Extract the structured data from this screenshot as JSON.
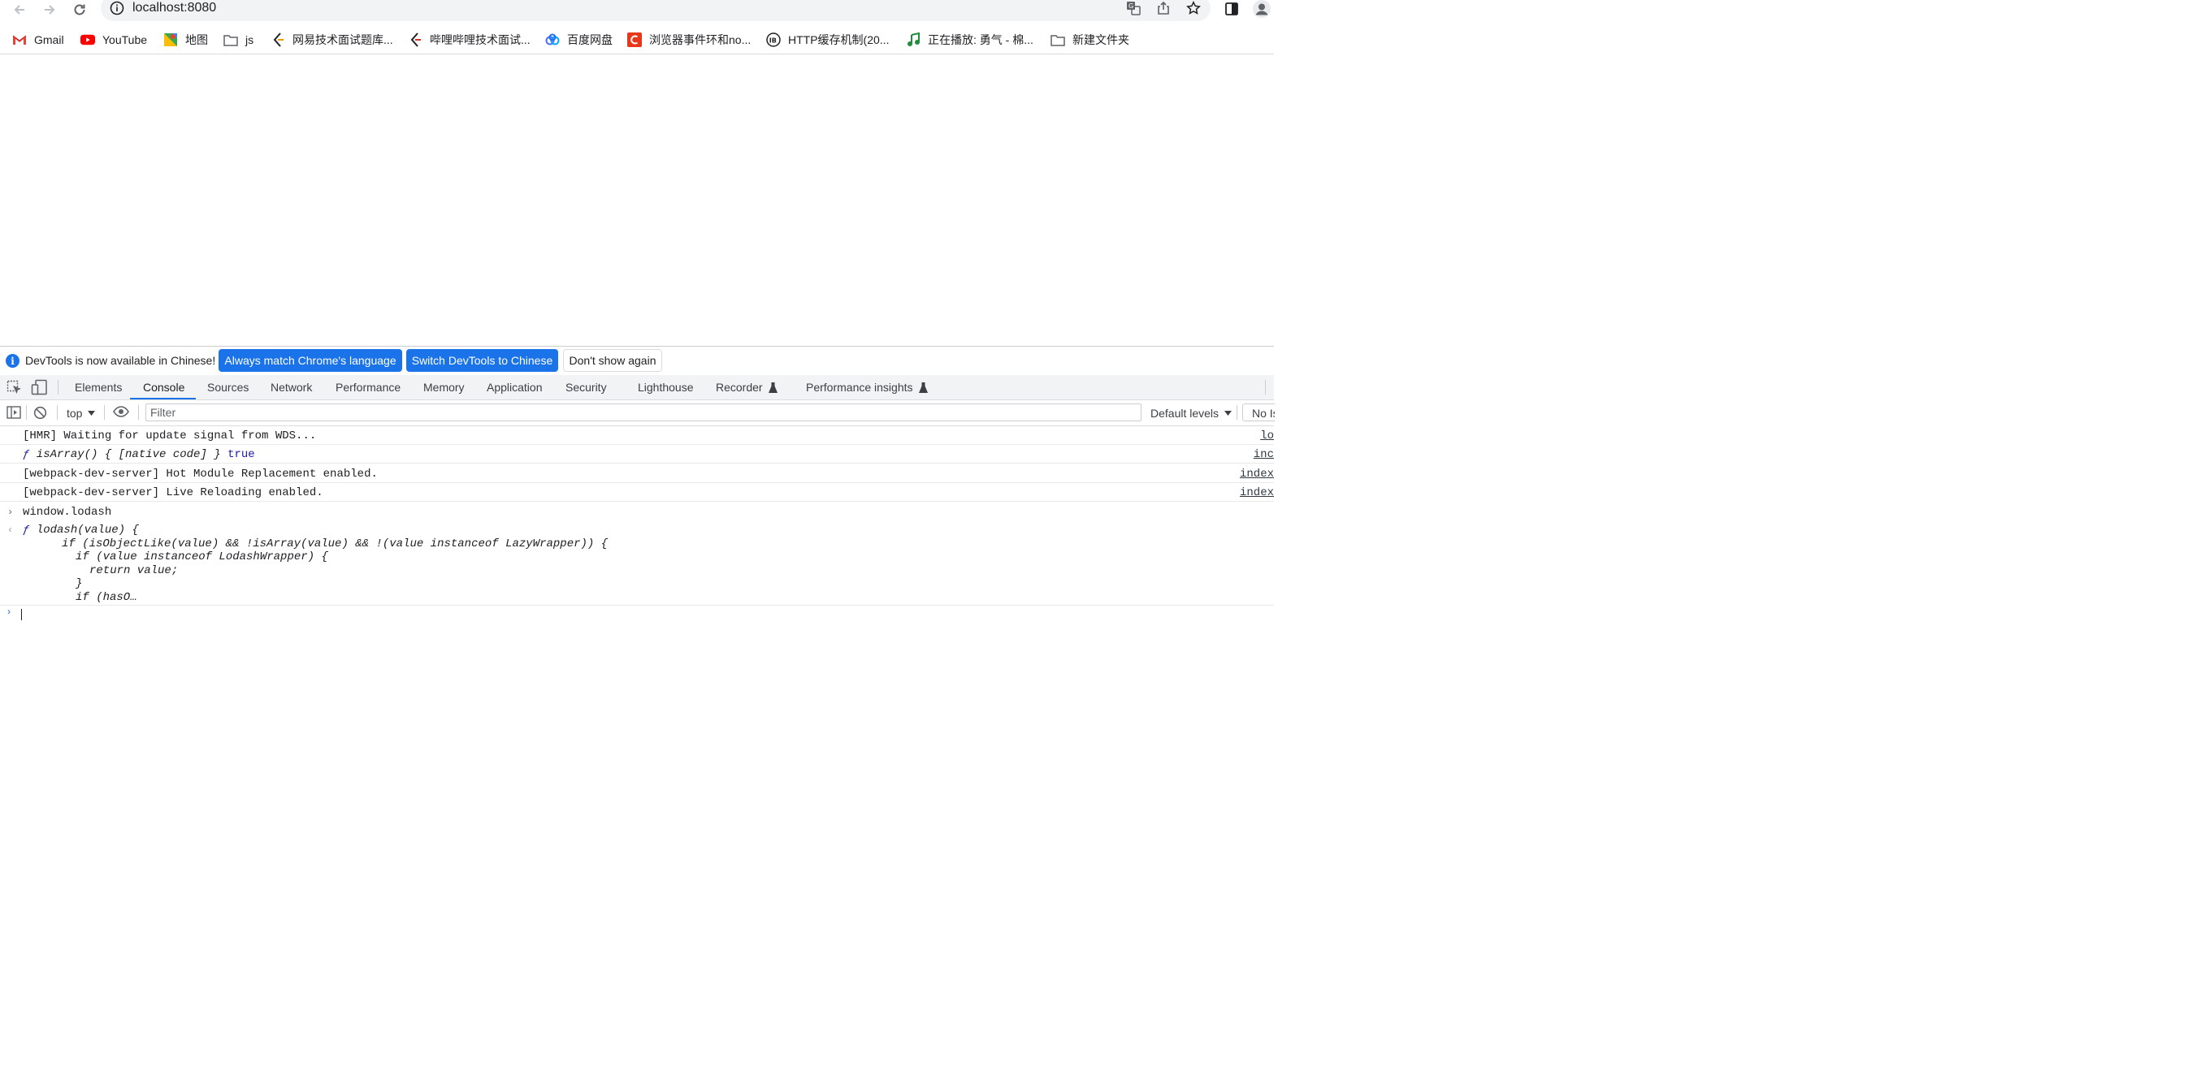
{
  "browser": {
    "url": "localhost:8080",
    "bookmarks": [
      {
        "label": "Gmail",
        "icon": "gmail-icon"
      },
      {
        "label": "YouTube",
        "icon": "youtube-icon"
      },
      {
        "label": "地图",
        "icon": "maps-icon"
      },
      {
        "label": "js",
        "icon": "folder-icon"
      },
      {
        "label": "网易技术面试题库...",
        "icon": "nowcoder-icon"
      },
      {
        "label": "哔哩哔哩技术面试...",
        "icon": "nowcoder-icon"
      },
      {
        "label": "百度网盘",
        "icon": "baidu-pan-icon"
      },
      {
        "label": "浏览器事件环和no...",
        "icon": "c-letter-icon"
      },
      {
        "label": "HTTP缓存机制(20...",
        "icon": "ib-circle-icon"
      },
      {
        "label": "正在播放: 勇气 - 棉...",
        "icon": "music-note-icon"
      },
      {
        "label": "新建文件夹",
        "icon": "folder-icon"
      }
    ]
  },
  "devtools": {
    "infobar": {
      "message": "DevTools is now available in Chinese!",
      "btn_match": "Always match Chrome's language",
      "btn_switch": "Switch DevTools to Chinese",
      "btn_dismiss": "Don't show again"
    },
    "tabs": {
      "elements": "Elements",
      "console": "Console",
      "sources": "Sources",
      "network": "Network",
      "performance": "Performance",
      "memory": "Memory",
      "application": "Application",
      "security": "Security",
      "lighthouse": "Lighthouse",
      "recorder": "Recorder",
      "perf_insights": "Performance insights"
    },
    "console_bar": {
      "context": "top",
      "filter_placeholder": "Filter",
      "levels": "Default levels",
      "issues": "No Is"
    },
    "logs": {
      "l1_text": "[HMR] Waiting for update signal from WDS...",
      "l1_src": "lo",
      "l2_f": "ƒ",
      "l2_text": " isArray() { [native code] }",
      "l2_true": "true",
      "l2_src": "inc",
      "l3_text": "[webpack-dev-server] Hot Module Replacement enabled.",
      "l3_src": "index",
      "l4_text": "[webpack-dev-server] Live Reloading enabled.",
      "l4_src": "index",
      "input": "window.lodash",
      "result": {
        "f": "ƒ",
        "line1": "lodash(value) {",
        "line2": "if (isObjectLike(value) && !isArray(value) && !(value instanceof LazyWrapper)) {",
        "line3": "if (value instanceof LodashWrapper) {",
        "line4": "return value;",
        "line5": "}",
        "line6": "if (hasO…"
      }
    }
  }
}
